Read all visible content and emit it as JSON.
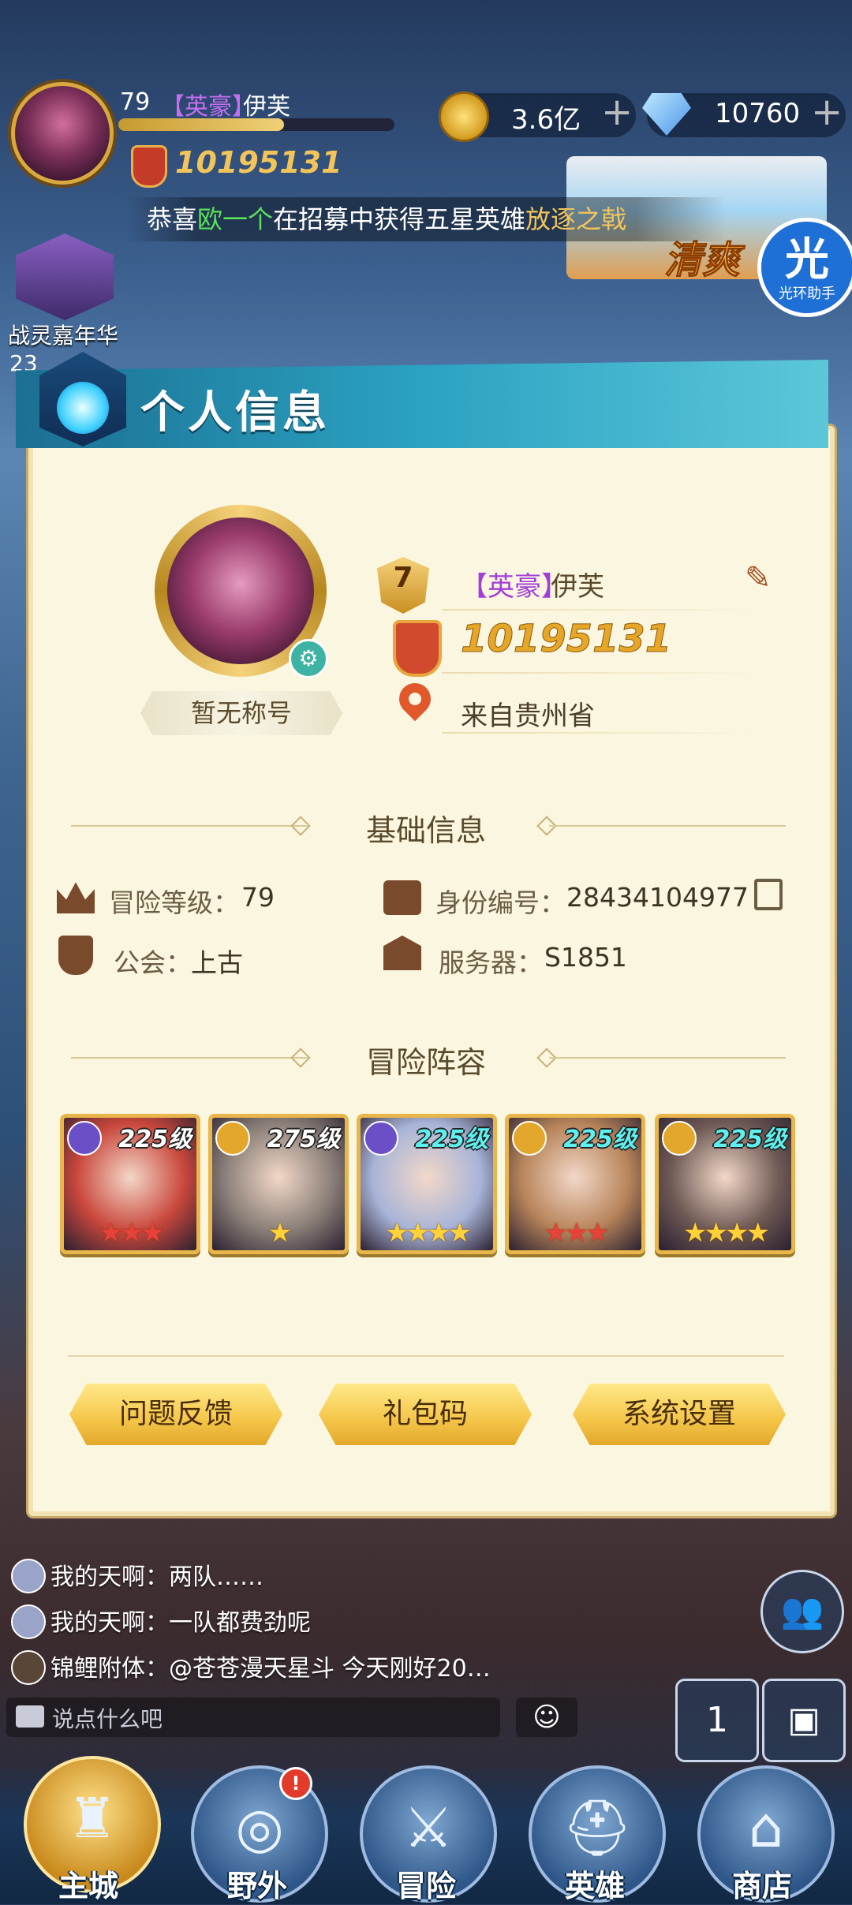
{
  "hud": {
    "level": "79",
    "rank_tag": "【英豪】",
    "player_name": "伊芙",
    "power": "10195131",
    "gold": "3.6亿",
    "diamonds": "10760",
    "plus": "+"
  },
  "marquee": {
    "prefix": "恭喜",
    "player": "欧一个",
    "middle": "在招募中获得五星英雄",
    "hero": "放逐之戟"
  },
  "banner": {
    "text": "清爽"
  },
  "helper": {
    "big": "光",
    "small": "光环助手"
  },
  "event": {
    "label": "战灵嘉年华",
    "sub": "23"
  },
  "panel": {
    "title": "个人信息",
    "title_badge": "暂无称号",
    "level": "7",
    "rank_tag": "【英豪】",
    "name": "伊芙",
    "power": "10195131",
    "location": "来自贵州省",
    "basic_title": "基础信息",
    "adventure_level_label": "冒险等级：",
    "adventure_level": "79",
    "id_label": "身份编号：",
    "id_value": "28434104977",
    "guild_label": "公会：",
    "guild_value": "上古",
    "server_label": "服务器：",
    "server_value": "S1851",
    "lineup_title": "冒险阵容",
    "lineup": [
      {
        "level": "225级",
        "stars": "★★★",
        "star_color": "#e8413a",
        "level_color": "#ffffff",
        "badge": "#6b4fc7",
        "bg": "#c9473c"
      },
      {
        "level": "275级",
        "stars": "★",
        "star_color": "#ffd23a",
        "level_color": "#ffffff",
        "badge": "#e2a72b",
        "bg": "#8a7f78"
      },
      {
        "level": "225级",
        "stars": "★★★★",
        "star_color": "#ffd23a",
        "level_color": "#5ff0f0",
        "badge": "#6b4fc7",
        "bg": "#a8b4d8"
      },
      {
        "level": "225级",
        "stars": "★★★",
        "star_color": "#e8413a",
        "level_color": "#5ff0f0",
        "badge": "#e2a72b",
        "bg": "#b7845a"
      },
      {
        "level": "225级",
        "stars": "★★★★",
        "star_color": "#ffd23a",
        "level_color": "#5ff0f0",
        "badge": "#e2a72b",
        "bg": "#6f5a55"
      }
    ],
    "buttons": [
      "问题反馈",
      "礼包码",
      "系统设置"
    ]
  },
  "chat": {
    "lines": [
      {
        "speaker": "我的天啊：",
        "text": "两队……"
      },
      {
        "speaker": "我的天啊：",
        "text": "一队都费劲呢"
      },
      {
        "speaker": "锦鲤附体：",
        "text": "@苍苍漫天星斗 今天刚好20…"
      }
    ],
    "placeholder": "说点什么吧"
  },
  "nav": {
    "items": [
      "主城",
      "野外",
      "冒险",
      "英雄",
      "商店"
    ],
    "alert": "!"
  },
  "colors": {
    "accent_gold": "#e6a728",
    "rank_purple": "#a23ed8",
    "marquee_green": "#5be05b",
    "marquee_gold": "#f2c55b"
  }
}
